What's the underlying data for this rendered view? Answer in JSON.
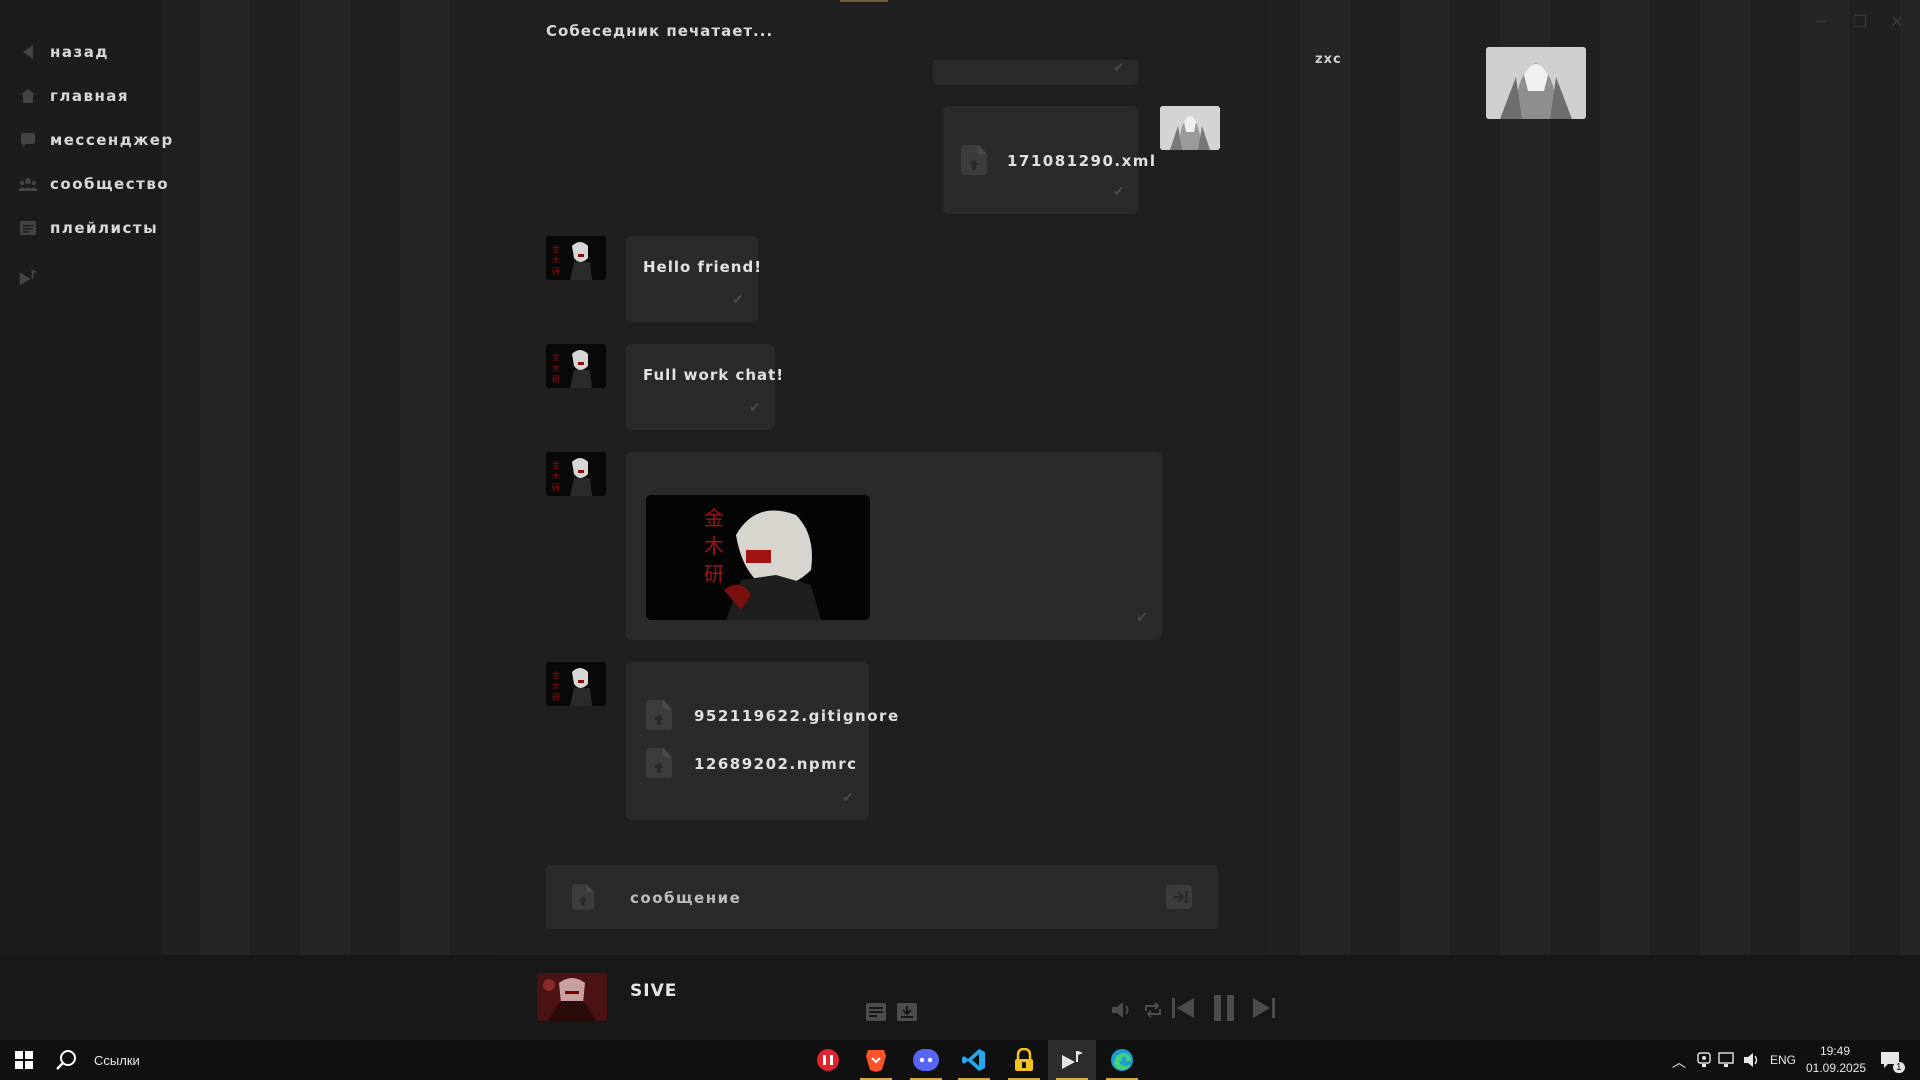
{
  "sidebar": {
    "items": [
      {
        "label": "назад",
        "icon": "back-arrow-icon"
      },
      {
        "label": "главная",
        "icon": "home-icon"
      },
      {
        "label": "мессенджер",
        "icon": "chat-bubble-icon"
      },
      {
        "label": "сообщество",
        "icon": "community-icon"
      },
      {
        "label": "плейлисты",
        "icon": "playlist-icon"
      }
    ],
    "extra_icon": "music-upload-icon"
  },
  "chat": {
    "typing_status": "Собеседник печатает...",
    "messages": [
      {
        "type": "file",
        "sender": "me",
        "file_name": "171081290.xml"
      },
      {
        "type": "text",
        "sender": "other",
        "text": "Hello friend!"
      },
      {
        "type": "text",
        "sender": "other",
        "text": "Full work chat!"
      },
      {
        "type": "image",
        "sender": "other"
      },
      {
        "type": "files",
        "sender": "other",
        "files": [
          "952119622.gitignore",
          "12689202.npmrc"
        ]
      }
    ],
    "composer": {
      "placeholder": "сообщение"
    }
  },
  "profile": {
    "name": "zxc"
  },
  "player": {
    "track_title": "SIVE"
  },
  "taskbar": {
    "search_label": "Ссылки",
    "apps": [
      "music-app-icon",
      "brave-browser-icon",
      "discord-icon",
      "vscode-icon",
      "lock-app-icon",
      "music-upload-app-icon",
      "edge-browser-icon"
    ],
    "language": "ENG",
    "time": "19:49",
    "date": "01.09.2025",
    "notification_count": "1"
  },
  "colors": {
    "background": "#202020",
    "sidebar": "#1c1c1c",
    "bubble": "#2a2a2a",
    "accent": "#d8a84a"
  }
}
